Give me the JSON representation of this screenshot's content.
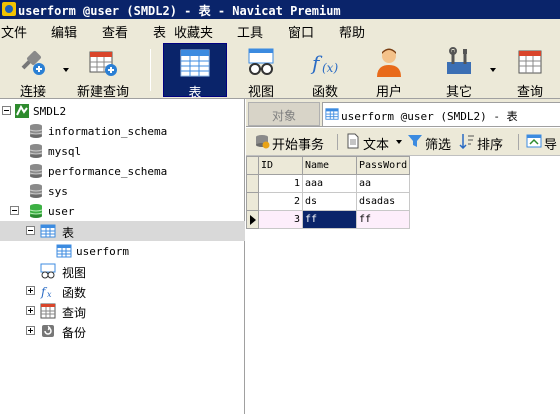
{
  "window": {
    "title": "userform @user (SMDL2) - 表 - Navicat Premium"
  },
  "menu": [
    "文件",
    "编辑",
    "查看",
    "表",
    "收藏夹",
    "工具",
    "窗口",
    "帮助"
  ],
  "toolbar": {
    "connect_label": "连接",
    "new_query_label": "新建查询",
    "table_label": "表",
    "view_label": "视图",
    "function_label": "函数",
    "user_label": "用户",
    "other_label": "其它",
    "query_label": "查询",
    "active": "表"
  },
  "tree": {
    "connection": "SMDL2",
    "databases": [
      "information_schema",
      "mysql",
      "performance_schema",
      "sys",
      "user"
    ],
    "open_database": "user",
    "tables_label": "表",
    "table_item": "userform",
    "views_label": "视图",
    "functions_label": "函数",
    "queries_label": "查询",
    "backups_label": "备份"
  },
  "tabs": {
    "objects_label": "对象",
    "active_label": "userform @user (SMDL2) - 表"
  },
  "subtoolbar": {
    "begin_transaction": "开始事务",
    "text": "文本",
    "filter": "筛选",
    "sort": "排序",
    "import": "导"
  },
  "grid": {
    "columns": [
      "ID",
      "Name",
      "PassWord"
    ],
    "rows": [
      {
        "id": "1",
        "name": "aaa",
        "password": "aa"
      },
      {
        "id": "2",
        "name": "ds",
        "password": "dsadas"
      },
      {
        "id": "3",
        "name": "ff",
        "password": "ff"
      }
    ],
    "current_row": 3
  },
  "colors": {
    "titlebar": "#0a246a",
    "active_toolbar": "#0a246a",
    "chrome": "#ece9d8",
    "selected_cell": "#0a246a",
    "current_row": "#fdeefb"
  }
}
